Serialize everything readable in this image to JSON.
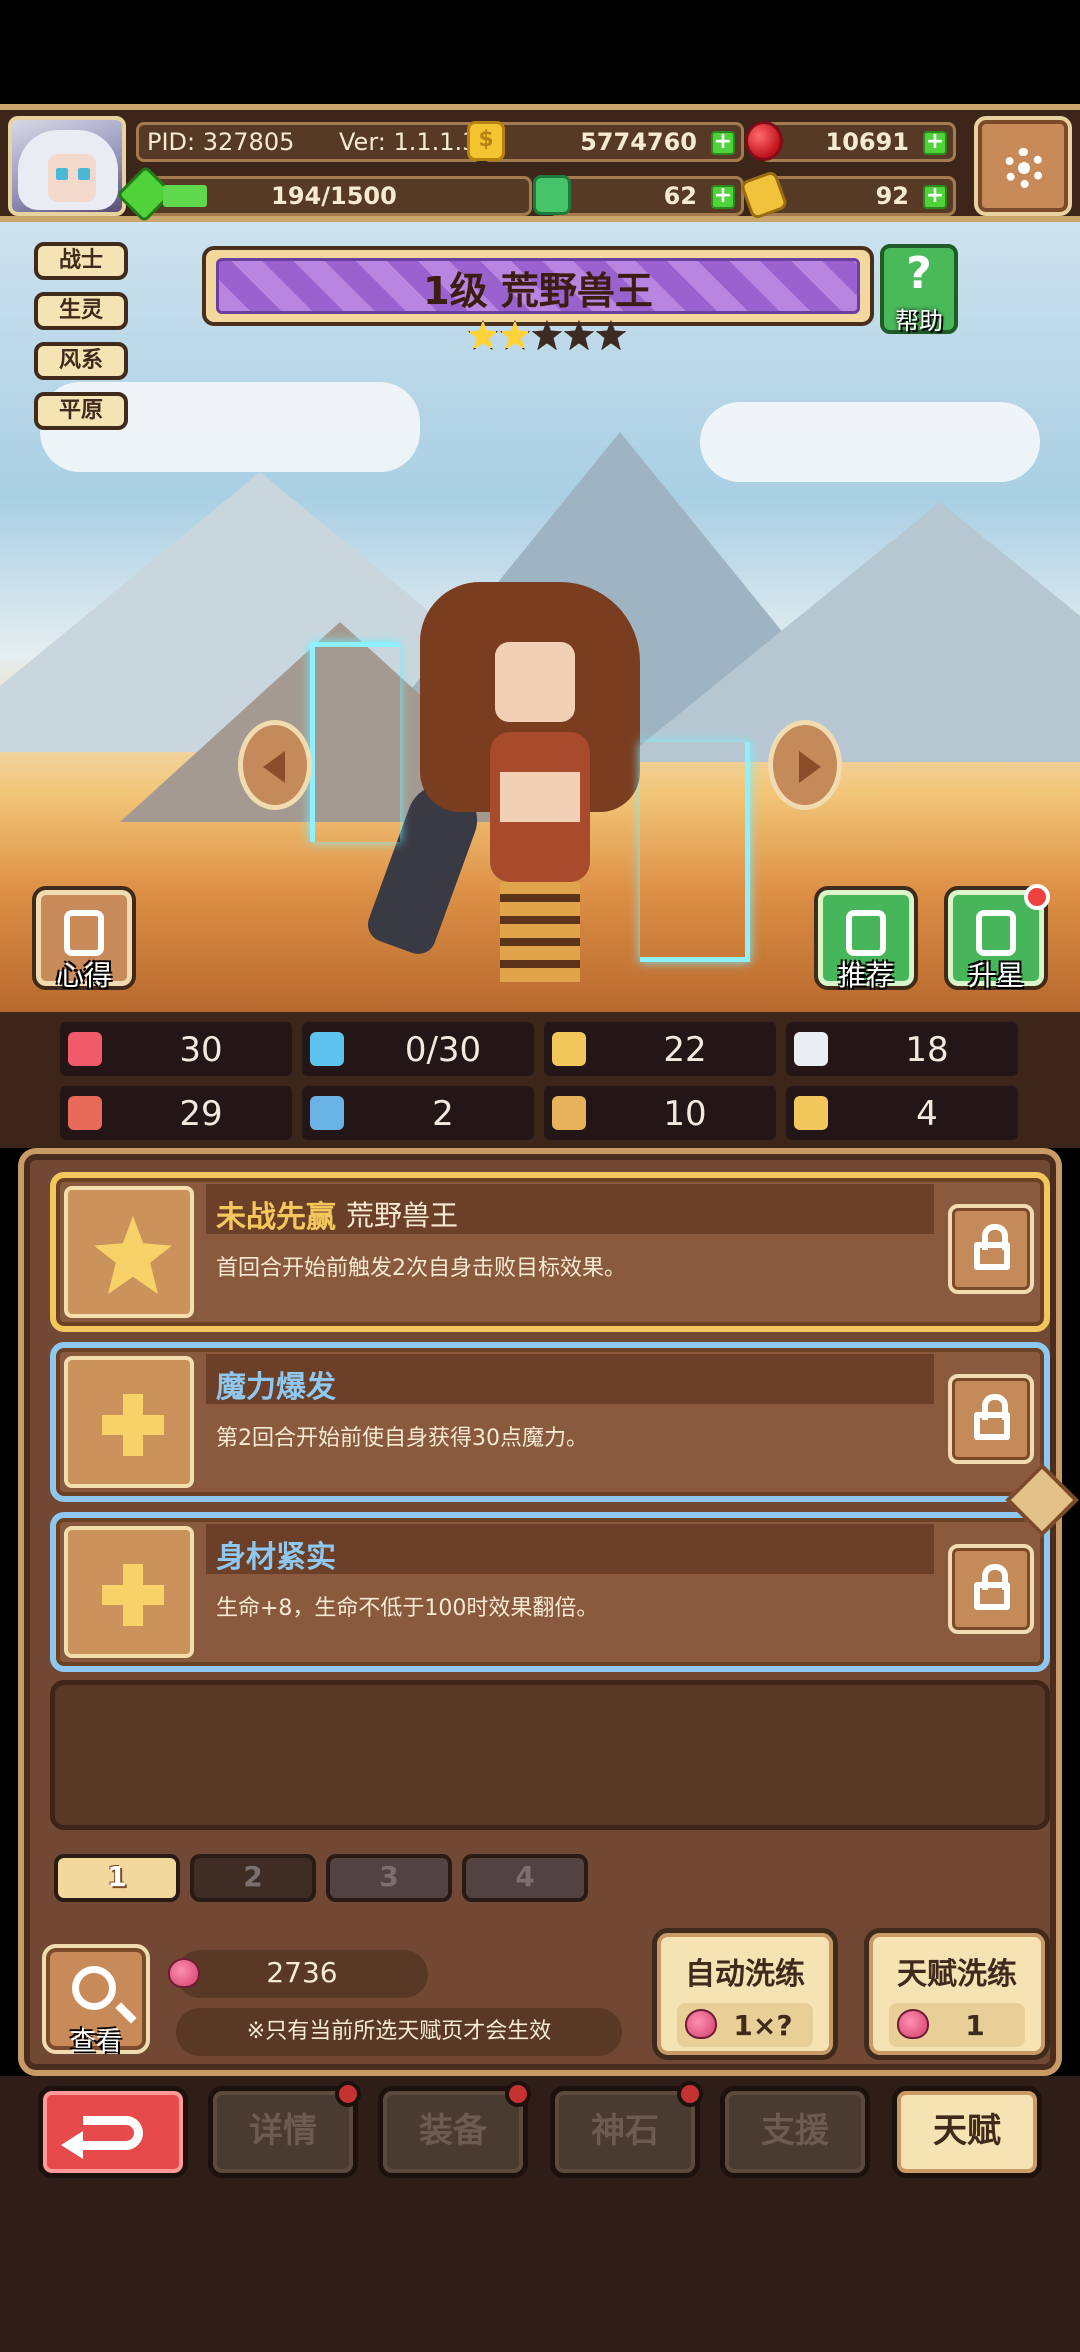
{
  "header": {
    "pid": "PID: 327805",
    "version": "Ver: 1.1.1.3",
    "coins": "5774760",
    "gems": "10691",
    "exp": "194/1500",
    "exp_progress": 0.13,
    "clover": "62",
    "boots": "92"
  },
  "tags": [
    "战士",
    "生灵",
    "风系",
    "平原"
  ],
  "hero": {
    "title": "1级  荒野兽王",
    "stars_total": 5,
    "stars_filled": 2,
    "help_label": "帮助",
    "insight_label": "心得",
    "recommend_label": "推荐",
    "starup_label": "升星"
  },
  "stats": [
    {
      "icon": "heart-icon",
      "value": "30",
      "color": "#f05a6a"
    },
    {
      "icon": "mana-drop-icon",
      "value": "0/30",
      "color": "#5fc3f0"
    },
    {
      "icon": "shield-icon",
      "value": "22",
      "color": "#f2c85c"
    },
    {
      "icon": "wing-icon",
      "value": "18",
      "color": "#e9eef2"
    },
    {
      "icon": "fist-icon",
      "value": "29",
      "color": "#e86a5a"
    },
    {
      "icon": "book-icon",
      "value": "2",
      "color": "#6ab3e6"
    },
    {
      "icon": "scroll-icon",
      "value": "10",
      "color": "#e7b25a"
    },
    {
      "icon": "horseshoe-icon",
      "value": "4",
      "color": "#f2c85c"
    }
  ],
  "talents": [
    {
      "name": "未战先赢",
      "owner": "荒野兽王",
      "desc": "首回合开始前触发2次自身击败目标效果。",
      "style": "gold"
    },
    {
      "name": "魔力爆发",
      "owner": "",
      "desc": "第2回合开始前使自身获得30点魔力。",
      "style": "blue"
    },
    {
      "name": "身材紧实",
      "owner": "",
      "desc": "生命+8，生命不低于100时效果翻倍。",
      "style": "blue"
    }
  ],
  "pages": [
    "1",
    "2",
    "3",
    "4"
  ],
  "active_page": "1",
  "bottom": {
    "view_label": "查看",
    "peach_count": "2736",
    "note": "※只有当前所选天赋页才会生效",
    "auto_reroll_label": "自动洗练",
    "auto_reroll_cost": "1×?",
    "talent_reroll_label": "天赋洗练",
    "talent_reroll_cost": "1"
  },
  "nav": {
    "details": "详情",
    "equip": "装备",
    "godstone": "神石",
    "support": "支援",
    "talent": "天赋"
  },
  "colors": {
    "frame": "#c89b66",
    "panel": "#704833",
    "gold_border": "#f2c85c",
    "blue_border": "#8ec8f0",
    "green_button": "#47b65a",
    "red_button": "#e64a4a"
  }
}
